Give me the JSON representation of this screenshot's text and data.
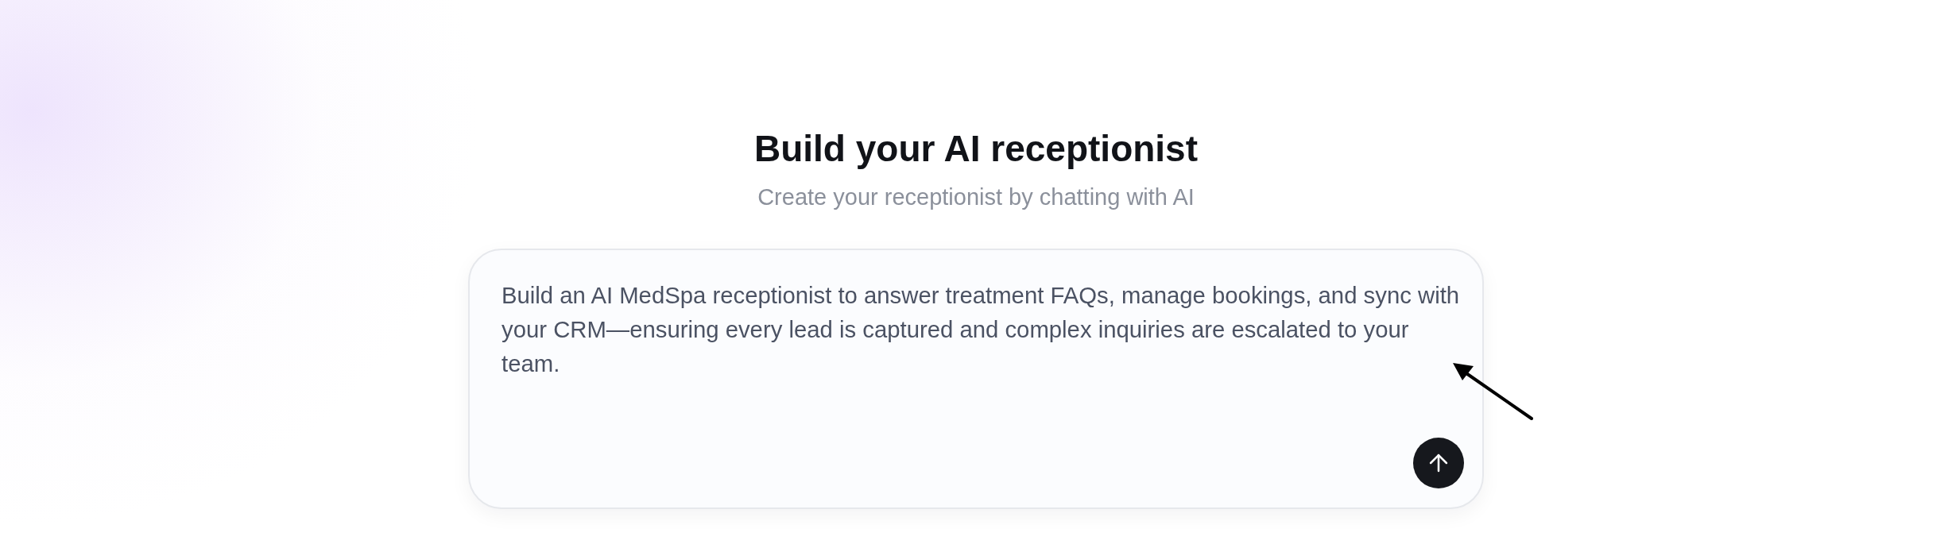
{
  "heading": {
    "title": "Build your AI receptionist",
    "subtitle": "Create your receptionist by chatting with AI"
  },
  "prompt": {
    "value": "Build an AI MedSpa receptionist to answer treatment FAQs, manage bookings, and sync with your CRM—ensuring every lead is captured and complex inquiries are escalated to your team."
  }
}
